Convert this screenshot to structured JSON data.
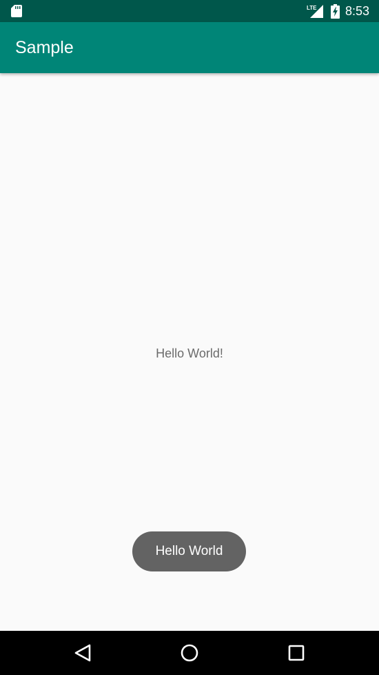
{
  "status_bar": {
    "time": "8:53",
    "network_label": "LTE",
    "icons": [
      "sd-card-icon",
      "lte-signal-icon",
      "battery-charging-icon"
    ],
    "background_color": "#00574b"
  },
  "app_bar": {
    "title": "Sample",
    "background_color": "#008577"
  },
  "main": {
    "center_text": "Hello World!"
  },
  "toast": {
    "text": "Hello World",
    "background_color": "#636363"
  },
  "nav_bar": {
    "buttons": [
      "back-icon",
      "home-icon",
      "recents-icon"
    ]
  }
}
